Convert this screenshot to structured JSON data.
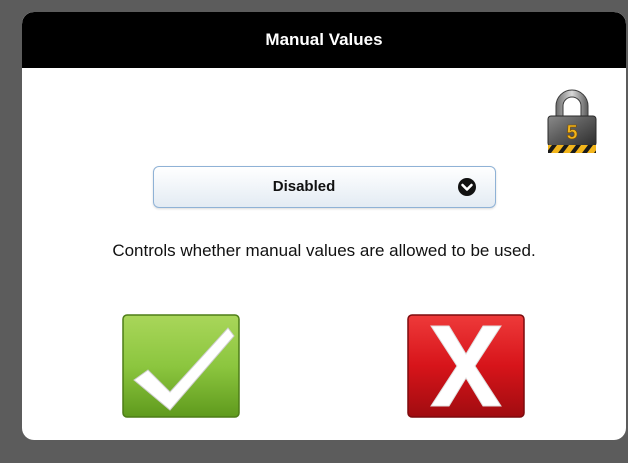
{
  "dialog": {
    "title": "Manual Values",
    "lock_level": "5",
    "select": {
      "value": "Disabled",
      "icon": "chevron-down-icon"
    },
    "description": "Controls whether manual values are allowed to be used.",
    "confirm_icon": "checkmark-icon",
    "cancel_icon": "close-icon"
  },
  "colors": {
    "titlebar": "#000000",
    "confirm_green": "#8cc63f",
    "cancel_red": "#d7141a",
    "lock_gold": "#f2b51b"
  }
}
